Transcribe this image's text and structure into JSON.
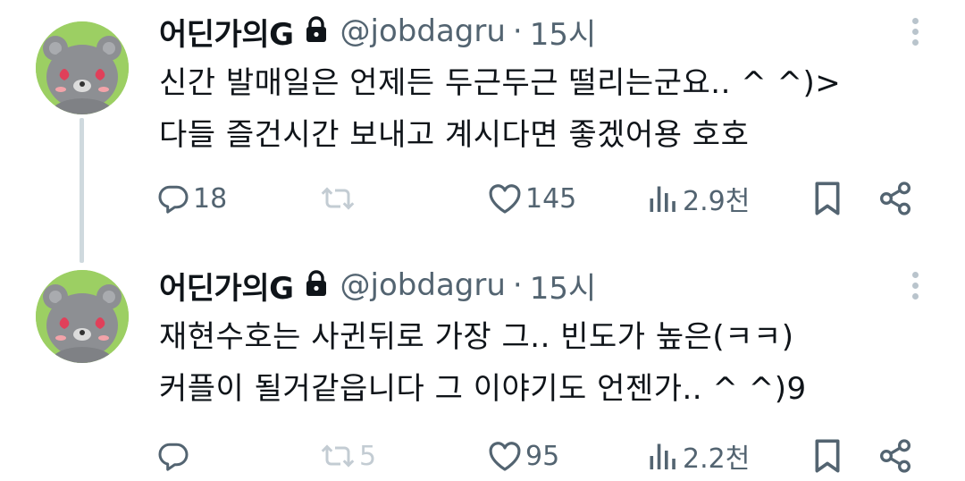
{
  "colors": {
    "text_primary": "#0f1419",
    "text_secondary": "#536471",
    "thread_line": "#cfd9de",
    "avatar_bg": "#9ccf63",
    "retweet_disabled": "#c3ccd3"
  },
  "tweets": [
    {
      "display_name": "어딘가의G",
      "handle": "@jobdagru",
      "separator": "·",
      "time": "15시",
      "lines": [
        "신간 발매일은 언제든 두근두근 떨리는군요.. ^ ^)>",
        "다들 즐건시간 보내고 계시다면 좋겠어용 호호"
      ],
      "replies": "18",
      "retweets": "",
      "likes": "145",
      "views": "2.9천"
    },
    {
      "display_name": "어딘가의G",
      "handle": "@jobdagru",
      "separator": "·",
      "time": "15시",
      "lines": [
        "재현수호는 사귄뒤로 가장 그.. 빈도가 높은(ㅋㅋ)",
        "커플이 될거같읍니다 그 이야기도 언젠가.. ^ ^)9"
      ],
      "replies": "",
      "retweets": "5",
      "likes": "95",
      "views": "2.2천"
    }
  ],
  "icons": {
    "avatar": "gray-bear-avatar-icon",
    "lock": "lock-icon",
    "more": "more-vertical-icon",
    "reply": "reply-icon",
    "retweet": "retweet-icon",
    "like": "heart-icon",
    "views": "views-bar-chart-icon",
    "bookmark": "bookmark-icon",
    "share": "share-icon"
  }
}
